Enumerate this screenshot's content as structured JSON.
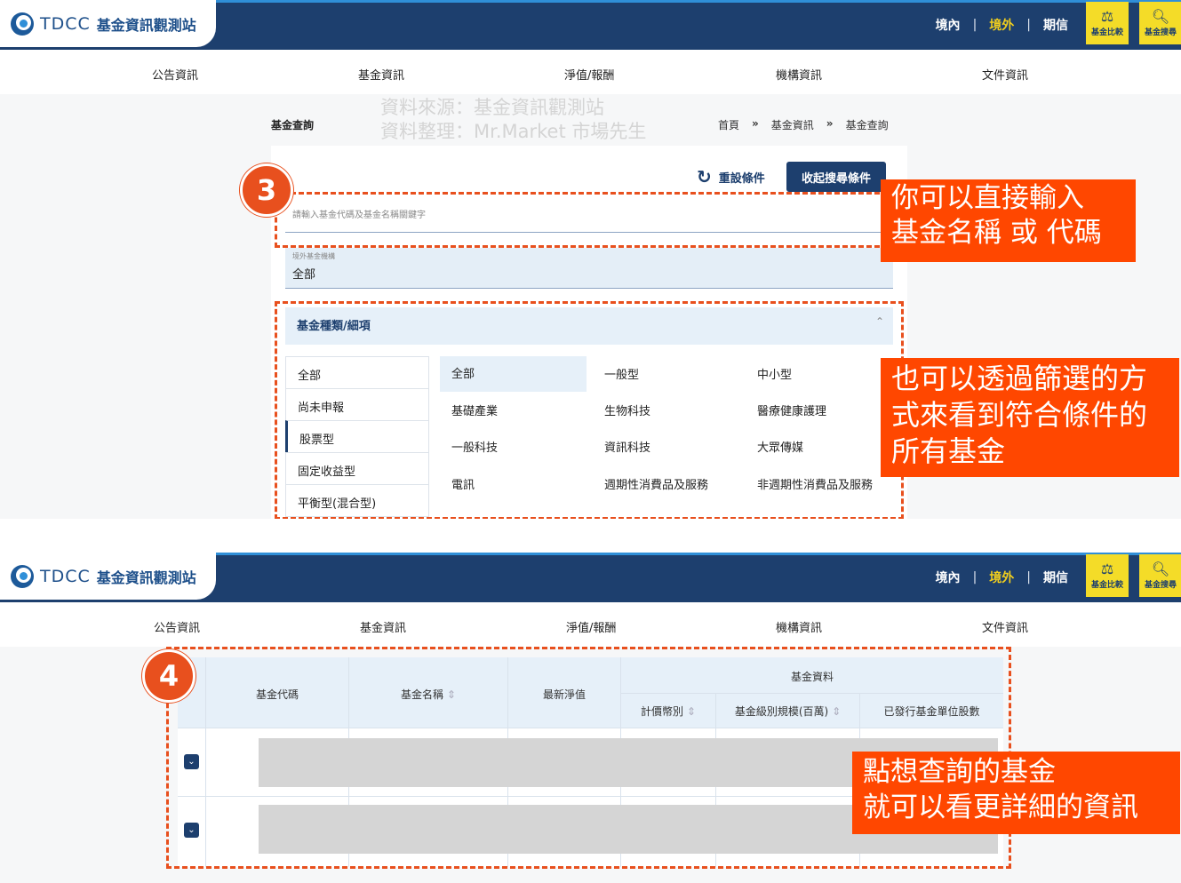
{
  "header": {
    "logo_text": "TDCC",
    "site_name": "基金資訊觀測站",
    "nav": {
      "domestic": "境內",
      "foreign": "境外",
      "futures": "期信",
      "sep": "|"
    },
    "compare_label": "基金比較",
    "search_label": "基金搜尋"
  },
  "main_nav": [
    "公告資訊",
    "基金資訊",
    "淨值/報酬",
    "機構資訊",
    "文件資訊"
  ],
  "watermark": {
    "line1": "資料來源：基金資訊觀測站",
    "line2": "資料整理：Mr.Market 市場先生"
  },
  "page": {
    "title": "基金查詢",
    "breadcrumb": [
      "首頁",
      "基金資訊",
      "基金查詢"
    ],
    "breadcrumb_sep": "»"
  },
  "search": {
    "reset_label": "重設條件",
    "collapse_label": "收起搜尋條件",
    "placeholder": "請輸入基金代碼及基金名稱關鍵字",
    "institution_label": "境外基金機構",
    "institution_value": "全部",
    "category_header": "基金種類/細項"
  },
  "categories": [
    "全部",
    "尚未申報",
    "股票型",
    "固定收益型",
    "平衡型(混合型)"
  ],
  "subcategories": [
    "全部",
    "一般型",
    "中小型",
    "基礎產業",
    "生物科技",
    "醫療健康護理",
    "一般科技",
    "資訊科技",
    "大眾傳媒",
    "電訊",
    "週期性消費品及服務",
    "非週期性消費品及服務"
  ],
  "annotations": {
    "step3": "3",
    "step4": "4",
    "note1_line1": "你可以直接輸入",
    "note1_line2": "基金名稱 或 代碼",
    "note2_line1": "也可以透過篩選的方",
    "note2_line2": "式來看到符合條件的",
    "note2_line3": "所有基金",
    "note3_line1": "點想查詢的基金",
    "note3_line2": "就可以看更詳細的資訊"
  },
  "table": {
    "col_code": "基金代碼",
    "col_name": "基金名稱",
    "col_nav": "最新淨值",
    "col_group": "基金資料",
    "col_currency": "計價幣別",
    "col_size": "基金級別規模(百萬)",
    "col_units": "已發行基金單位股數"
  },
  "colors": {
    "brand": "#1d3f6e",
    "accent": "#ff4700",
    "highlight": "#f4dc28"
  }
}
